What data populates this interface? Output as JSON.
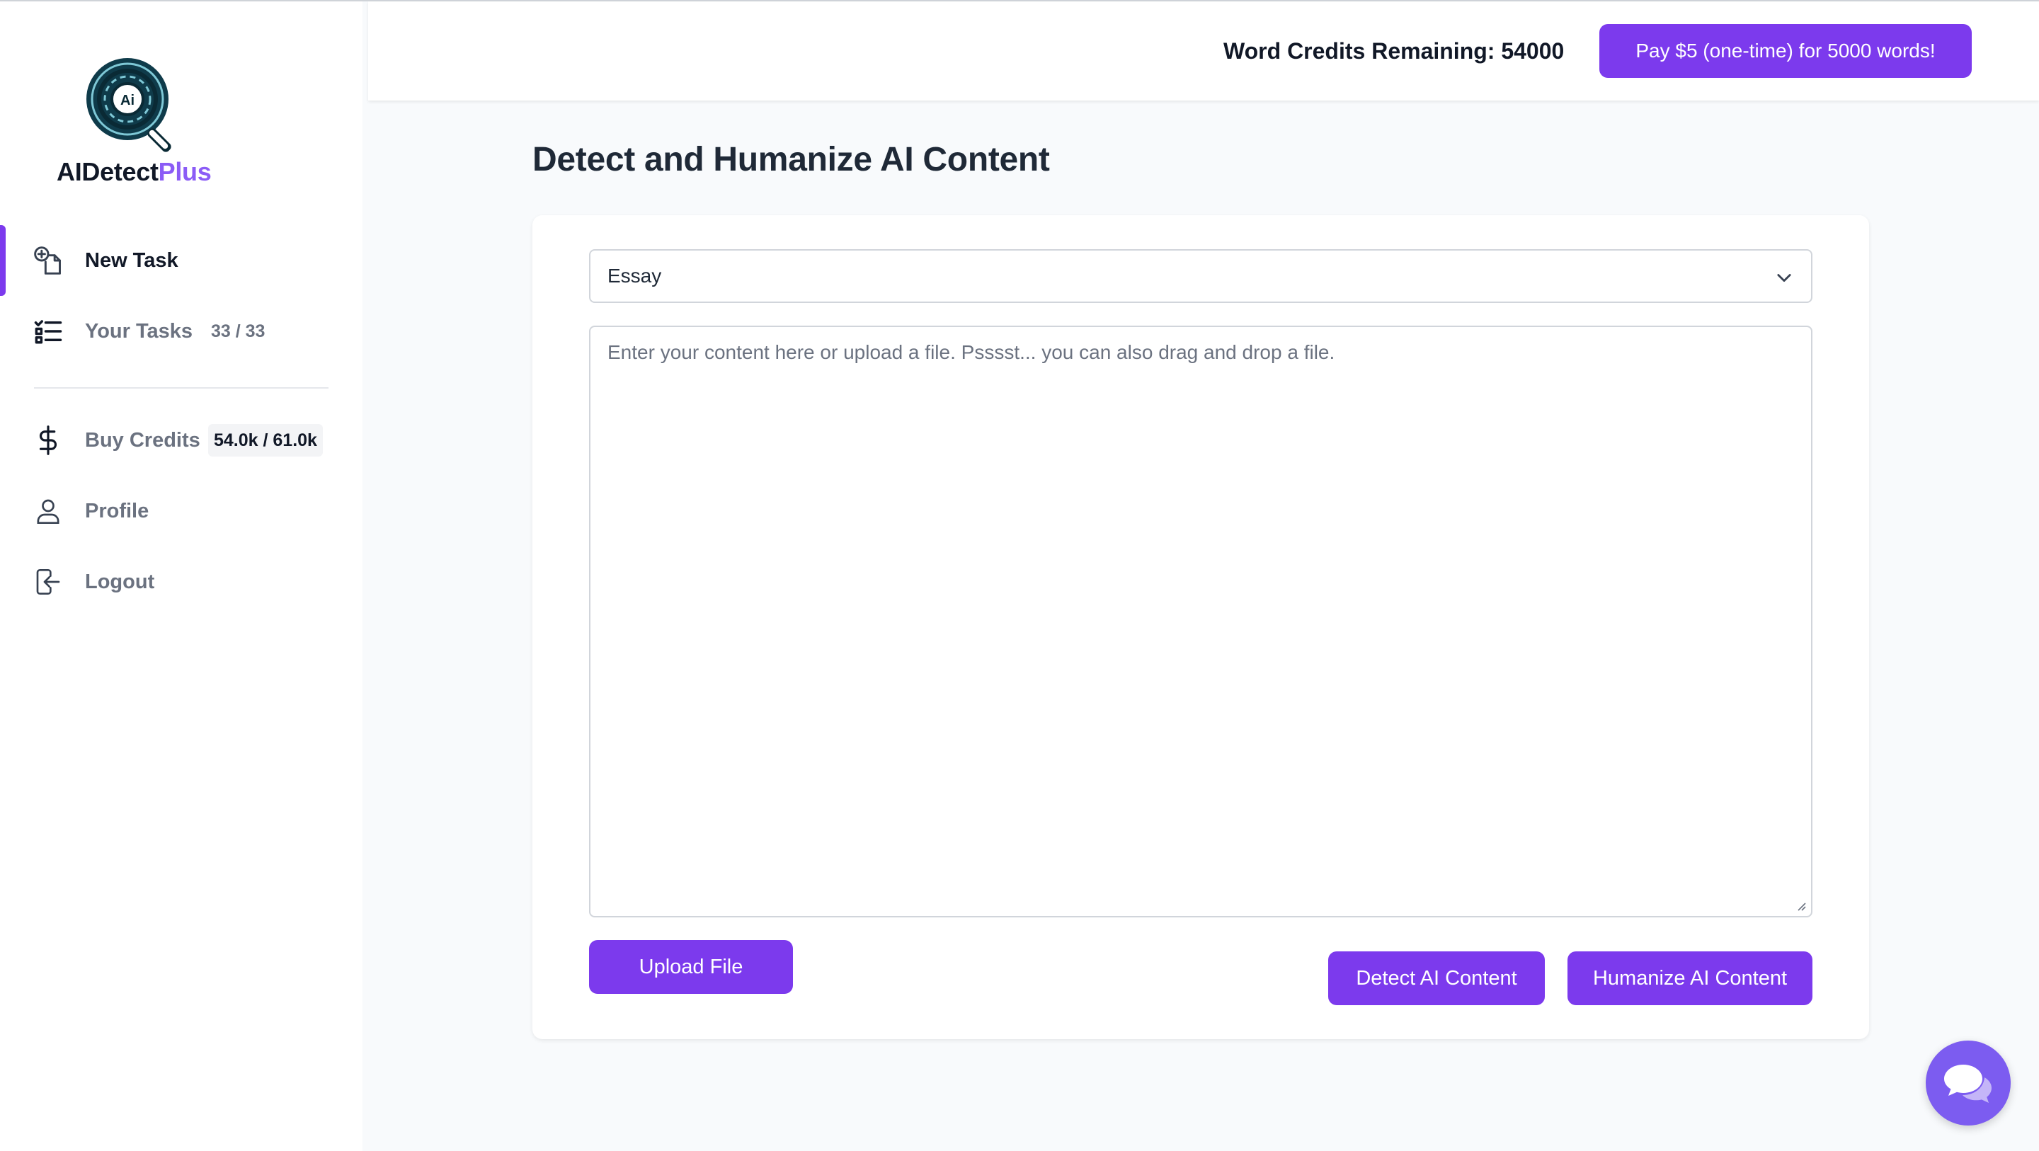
{
  "brand": {
    "name_main": "AIDetect",
    "name_accent": "Plus",
    "logo_letters": "Ai"
  },
  "sidebar": {
    "items": [
      {
        "label": "New Task",
        "icon": "new-task-icon",
        "active": true
      },
      {
        "label": "Your Tasks",
        "icon": "task-list-icon",
        "count": "33 / 33"
      },
      {
        "label": "Buy Credits",
        "icon": "dollar-icon",
        "badge": "54.0k / 61.0k"
      },
      {
        "label": "Profile",
        "icon": "user-icon"
      },
      {
        "label": "Logout",
        "icon": "logout-icon"
      }
    ]
  },
  "header": {
    "credits_text": "Word Credits Remaining: 54000",
    "pay_label": "Pay $5 (one-time) for 5000 words!"
  },
  "main": {
    "title": "Detect and Humanize AI Content",
    "content_type": "Essay",
    "textarea_placeholder": "Enter your content here or upload a file. Psssst... you can also drag and drop a file.",
    "upload_label": "Upload File",
    "detect_label": "Detect AI Content",
    "humanize_label": "Humanize AI Content"
  },
  "colors": {
    "accent": "#7c3aed",
    "accent_light": "#8b5cf6",
    "page_bg": "#f8fafc"
  }
}
